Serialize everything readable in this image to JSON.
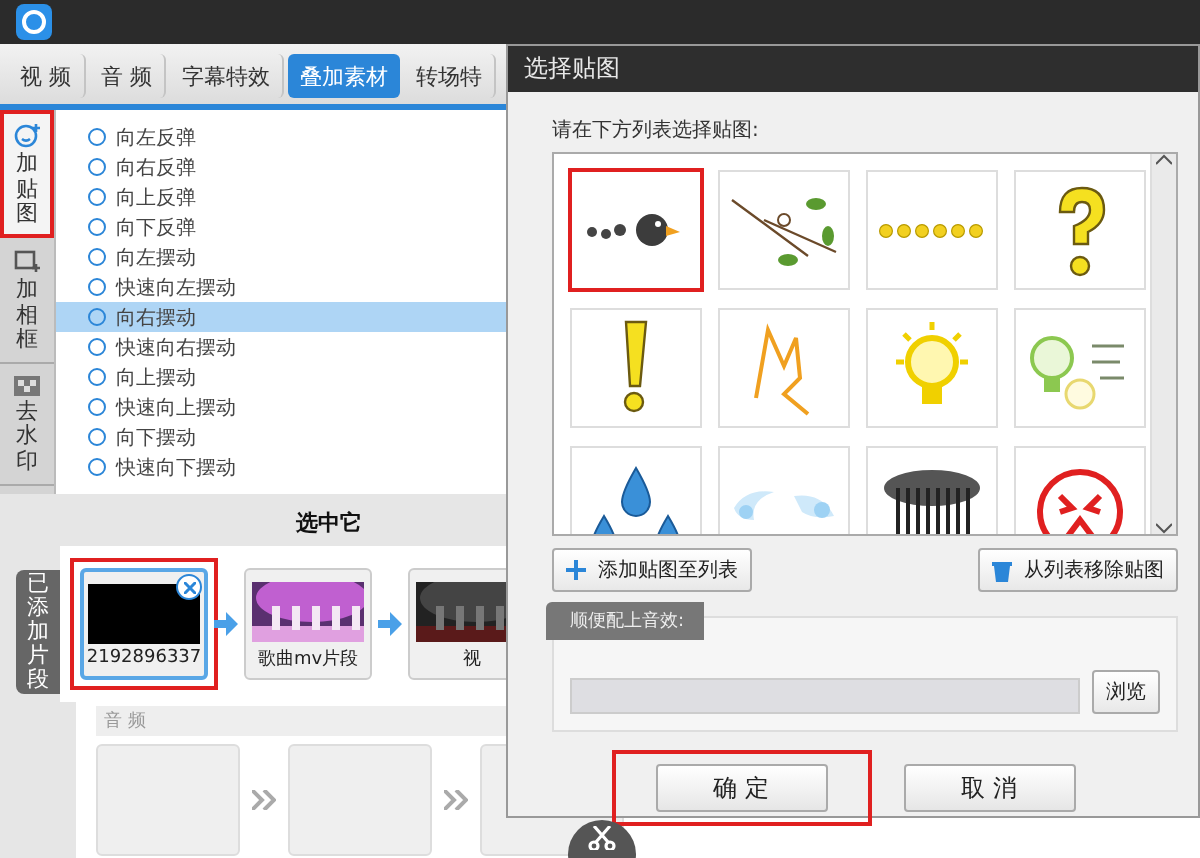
{
  "app": {
    "tabs": [
      {
        "label": "视 频",
        "selected": false
      },
      {
        "label": "音 频",
        "selected": false
      },
      {
        "label": "字幕特效",
        "selected": false
      },
      {
        "label": "叠加素材",
        "selected": true
      },
      {
        "label": "转场特",
        "selected": false
      }
    ],
    "side_tools": [
      {
        "label": "加贴图",
        "kind": "smiley",
        "highlighted": true
      },
      {
        "label": "加相框",
        "kind": "frame",
        "highlighted": false
      },
      {
        "label": "去水印",
        "kind": "mosaic",
        "highlighted": false
      }
    ],
    "effects": [
      {
        "label": "向左反弹",
        "selected": false
      },
      {
        "label": "向右反弹",
        "selected": false
      },
      {
        "label": "向上反弹",
        "selected": false
      },
      {
        "label": "向下反弹",
        "selected": false
      },
      {
        "label": "向左摆动",
        "selected": false
      },
      {
        "label": "快速向左摆动",
        "selected": false
      },
      {
        "label": "向右摆动",
        "selected": true
      },
      {
        "label": "快速向右摆动",
        "selected": false
      },
      {
        "label": "向上摆动",
        "selected": false
      },
      {
        "label": "快速向上摆动",
        "selected": false
      },
      {
        "label": "向下摆动",
        "selected": false
      },
      {
        "label": "快速向下摆动",
        "selected": false
      }
    ],
    "hint": "选中它",
    "clips_tab": "已添加片段",
    "clips": [
      {
        "kind": "black",
        "caption": "2192896337",
        "selected": true,
        "highlighted": true
      },
      {
        "kind": "picture",
        "caption": "歌曲mv片段",
        "selected": false,
        "highlighted": false
      },
      {
        "kind": "picture",
        "caption": "视",
        "selected": false,
        "highlighted": false
      }
    ],
    "audio_label": "音 频"
  },
  "dialog": {
    "title": "选择贴图",
    "instruction": "请在下方列表选择贴图:",
    "stickers": [
      {
        "kind": "bird",
        "highlighted": true
      },
      {
        "kind": "vine",
        "highlighted": false
      },
      {
        "kind": "dots",
        "highlighted": false
      },
      {
        "kind": "question",
        "highlighted": false
      },
      {
        "kind": "exclaim",
        "highlighted": false
      },
      {
        "kind": "zigzag",
        "highlighted": false
      },
      {
        "kind": "bulb",
        "highlighted": false
      },
      {
        "kind": "bulbs",
        "highlighted": false
      },
      {
        "kind": "drops",
        "highlighted": false
      },
      {
        "kind": "wind",
        "highlighted": false
      },
      {
        "kind": "rain",
        "highlighted": false
      },
      {
        "kind": "angry",
        "highlighted": false
      }
    ],
    "add_button": "添加贴图至列表",
    "remove_button": "从列表移除贴图",
    "sound_label": "顺便配上音效:",
    "browse_button": "浏览",
    "ok_button": "确 定",
    "ok_highlighted": true,
    "cancel_button": "取 消"
  }
}
